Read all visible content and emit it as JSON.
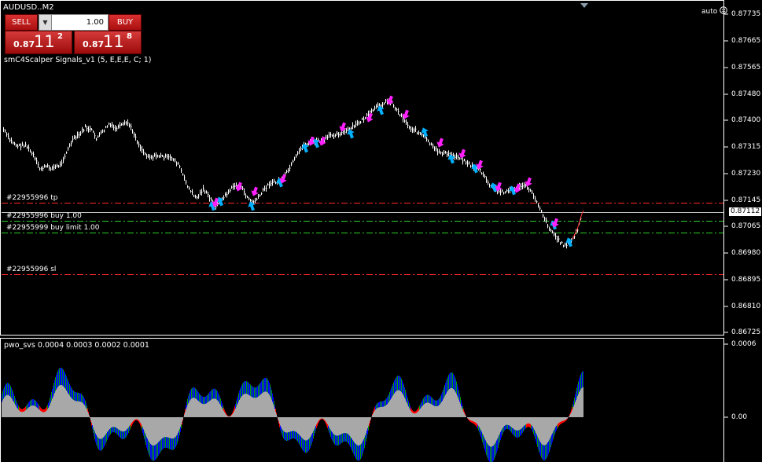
{
  "header": {
    "symbol_title": "AUDUSD..M2",
    "indicator_label": "smC4Scalper Signals_v1 (5, E,E,E, C; 1)",
    "auto_label": "auto"
  },
  "trade_panel": {
    "sell_label": "SELL",
    "buy_label": "BUY",
    "lot_value": "1.00",
    "sell_quote": {
      "small": "0.87",
      "big": "11",
      "sup": "2"
    },
    "buy_quote": {
      "small": "0.87",
      "big": "11",
      "sup": "8"
    }
  },
  "price_axis": {
    "labels": [
      "0.87735",
      "0.87665",
      "0.87565",
      "0.87480",
      "0.87400",
      "0.87315",
      "0.87230",
      "0.87145",
      "0.87065",
      "0.86980",
      "0.86895",
      "0.86810",
      "0.86725"
    ],
    "current_price": "0.87112"
  },
  "orders": [
    {
      "label": "#22955996 tp",
      "type": "tp",
      "color": "#ff2020"
    },
    {
      "label": "#22955996 buy 1.00",
      "type": "buy",
      "color": "#c0c0c0"
    },
    {
      "label": "#22955999 buy limit 1.00",
      "type": "limit",
      "color": "#20d020"
    },
    {
      "label": "#22955996 sl",
      "type": "sl",
      "color": "#ff2020"
    }
  ],
  "subwindow": {
    "label": "pwo_svs 0.0004 0.0003 0.0002 0.0001",
    "axis_labels": [
      "0.0006",
      "0.00"
    ]
  },
  "colors": {
    "background": "#000000",
    "candles": "#ffffff",
    "up_arrow": "#00b0ff",
    "down_arrow": "#ff20ff",
    "histogram_gray": "#a8a8a8",
    "histogram_blue": "#0000ff",
    "histogram_green": "#00a000",
    "histogram_red": "#ff0000"
  },
  "icons": {
    "smiley": "smiley-icon",
    "scroll_marker": "triangle-down-icon"
  }
}
